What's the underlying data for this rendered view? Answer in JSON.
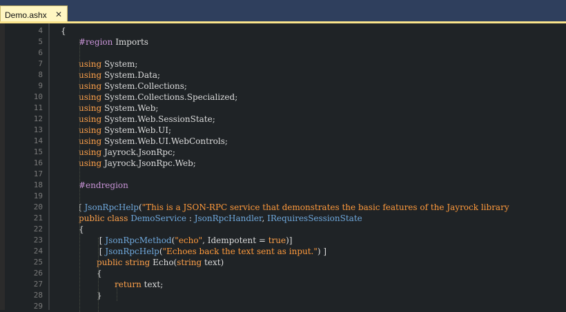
{
  "tab": {
    "title": "Demo.ashx",
    "close_glyph": "✕"
  },
  "colors": {
    "tabbar": "#2f3f5d",
    "tab_active": "#fff6c2",
    "editor_bg": "#1f2326",
    "keyword": "#ffa14a",
    "preprocessor": "#c994d8",
    "type": "#6fa8dc",
    "string": "#ff9a3c",
    "plain": "#dcdcdc",
    "line_number": "#7a7a7a"
  },
  "lines": [
    {
      "n": "4",
      "tokens": [
        [
          "pl",
          "{"
        ]
      ]
    },
    {
      "n": "5",
      "tokens": [
        [
          "pp",
          "#region"
        ],
        [
          "pl",
          " Imports"
        ]
      ]
    },
    {
      "n": "6",
      "tokens": []
    },
    {
      "n": "7",
      "tokens": [
        [
          "kw",
          "using"
        ],
        [
          "pl",
          " System;"
        ]
      ]
    },
    {
      "n": "8",
      "tokens": [
        [
          "kw",
          "using"
        ],
        [
          "pl",
          " System.Data;"
        ]
      ]
    },
    {
      "n": "9",
      "tokens": [
        [
          "kw",
          "using"
        ],
        [
          "pl",
          " System.Collections;"
        ]
      ]
    },
    {
      "n": "10",
      "tokens": [
        [
          "kw",
          "using"
        ],
        [
          "pl",
          " System.Collections.Specialized;"
        ]
      ]
    },
    {
      "n": "11",
      "tokens": [
        [
          "kw",
          "using"
        ],
        [
          "pl",
          " System.Web;"
        ]
      ]
    },
    {
      "n": "12",
      "tokens": [
        [
          "kw",
          "using"
        ],
        [
          "pl",
          " System.Web.SessionState;"
        ]
      ]
    },
    {
      "n": "13",
      "tokens": [
        [
          "kw",
          "using"
        ],
        [
          "pl",
          " System.Web.UI;"
        ]
      ]
    },
    {
      "n": "14",
      "tokens": [
        [
          "kw",
          "using"
        ],
        [
          "pl",
          " System.Web.UI.WebControls;"
        ]
      ]
    },
    {
      "n": "15",
      "tokens": [
        [
          "kw",
          "using"
        ],
        [
          "pl",
          " Jayrock.JsonRpc;"
        ]
      ]
    },
    {
      "n": "16",
      "tokens": [
        [
          "kw",
          "using"
        ],
        [
          "pl",
          " Jayrock.JsonRpc.Web;"
        ]
      ]
    },
    {
      "n": "17",
      "tokens": []
    },
    {
      "n": "18",
      "tokens": [
        [
          "pp",
          "#endregion"
        ]
      ]
    },
    {
      "n": "19",
      "tokens": []
    },
    {
      "n": "20",
      "tokens": [
        [
          "pl",
          "[ "
        ],
        [
          "ty",
          "JsonRpcHelp"
        ],
        [
          "pl",
          "("
        ],
        [
          "st",
          "\"This is a JSON-RPC service that demonstrates the basic features of the Jayrock library"
        ]
      ]
    },
    {
      "n": "21",
      "tokens": [
        [
          "kw",
          "public"
        ],
        [
          "pl",
          " "
        ],
        [
          "kw",
          "class"
        ],
        [
          "pl",
          " "
        ],
        [
          "ty",
          "DemoService"
        ],
        [
          "pl",
          " : "
        ],
        [
          "ty",
          "JsonRpcHandler"
        ],
        [
          "pl",
          ", "
        ],
        [
          "ty",
          "IRequiresSessionState"
        ]
      ]
    },
    {
      "n": "22",
      "tokens": [
        [
          "pl",
          "{"
        ]
      ]
    },
    {
      "n": "23",
      "tokens": [
        [
          "pl",
          "[ "
        ],
        [
          "ty",
          "JsonRpcMethod"
        ],
        [
          "pl",
          "("
        ],
        [
          "st",
          "\"echo\""
        ],
        [
          "pl",
          ", Idempotent = "
        ],
        [
          "kw",
          "true"
        ],
        [
          "pl",
          ")]"
        ]
      ]
    },
    {
      "n": "24",
      "tokens": [
        [
          "pl",
          "[ "
        ],
        [
          "ty",
          "JsonRpcHelp"
        ],
        [
          "pl",
          "("
        ],
        [
          "st",
          "\"Echoes back the text sent as input.\""
        ],
        [
          "pl",
          ") ]"
        ]
      ]
    },
    {
      "n": "25",
      "tokens": [
        [
          "kw",
          "public"
        ],
        [
          "pl",
          " "
        ],
        [
          "kw",
          "string"
        ],
        [
          "pl",
          " Echo("
        ],
        [
          "kw",
          "string"
        ],
        [
          "pl",
          " text)"
        ]
      ]
    },
    {
      "n": "26",
      "tokens": [
        [
          "pl",
          "{"
        ]
      ]
    },
    {
      "n": "27",
      "tokens": [
        [
          "kw",
          "return"
        ],
        [
          "pl",
          " text;"
        ]
      ]
    },
    {
      "n": "28",
      "tokens": [
        [
          "pl",
          "}"
        ]
      ]
    },
    {
      "n": "29",
      "tokens": []
    }
  ]
}
